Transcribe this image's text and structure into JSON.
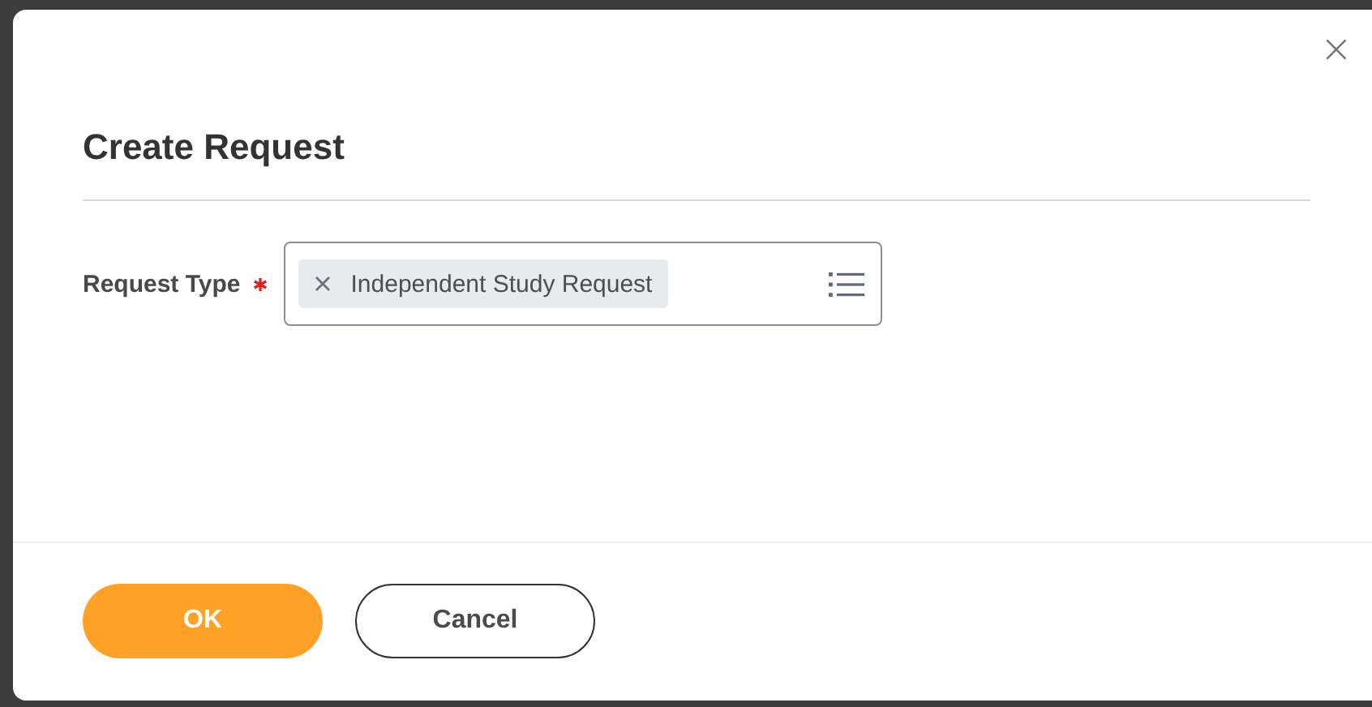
{
  "dialog": {
    "title": "Create Request",
    "close": "×"
  },
  "fields": [
    {
      "label": "Request Type",
      "required": true,
      "tokens": [
        {
          "text": "Independent Study Request"
        }
      ]
    }
  ],
  "buttons": [
    {
      "label": "OK",
      "kind": "primary"
    },
    {
      "label": "Cancel",
      "kind": "secondary"
    }
  ]
}
